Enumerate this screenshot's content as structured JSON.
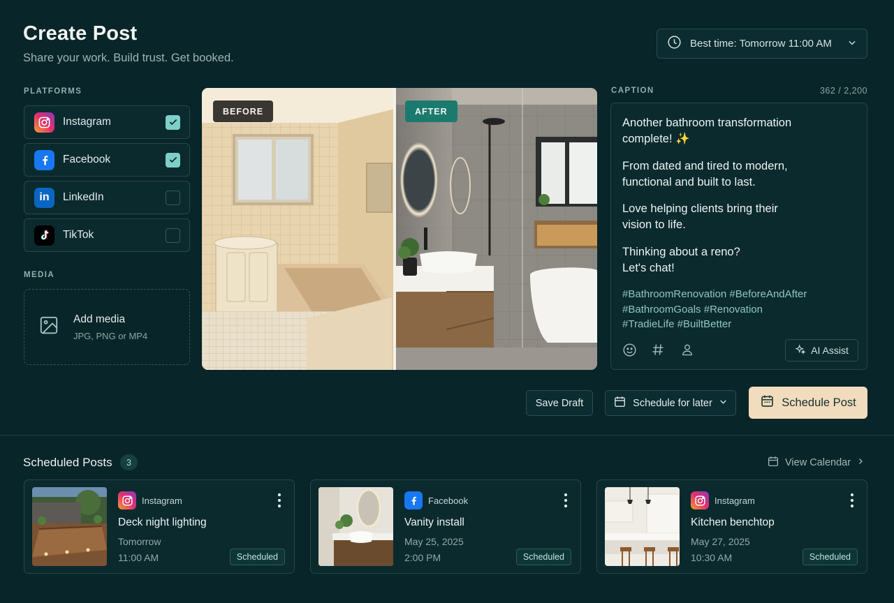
{
  "header": {
    "title": "Create Post",
    "subtitle": "Share your work. Build trust. Get booked.",
    "best_time": "Best time: Tomorrow 11:00 AM"
  },
  "platforms": {
    "label": "PLATFORMS",
    "items": [
      {
        "name": "Instagram",
        "checked": true,
        "icon": "instagram-icon"
      },
      {
        "name": "Facebook",
        "checked": true,
        "icon": "facebook-icon"
      },
      {
        "name": "LinkedIn",
        "checked": false,
        "icon": "linkedin-icon"
      },
      {
        "name": "TikTok",
        "checked": false,
        "icon": "tiktok-icon"
      }
    ]
  },
  "media": {
    "label": "MEDIA",
    "add_label": "Add media",
    "formats": "JPG, PNG or MP4"
  },
  "photo": {
    "before_label": "BEFORE",
    "after_label": "AFTER"
  },
  "caption": {
    "label": "CAPTION",
    "count": "362 / 2,200",
    "para1_line1": "Another bathroom transformation",
    "para1_line2": "complete! ✨",
    "para2_line1": "From dated and tired to modern,",
    "para2_line2": "functional and built to last.",
    "para3_line1": "Love helping clients bring their",
    "para3_line2": "vision to life.",
    "para4_line1": "Thinking about a reno?",
    "para4_line2": "Let's chat!",
    "hashtags_line1": "#BathroomRenovation #BeforeAndAfter",
    "hashtags_line2": "#BathroomGoals #Renovation",
    "hashtags_line3": "#TradieLife #BuiltBetter",
    "ai_assist": "AI Assist"
  },
  "actions": {
    "save_draft": "Save Draft",
    "schedule_later": "Schedule for later",
    "schedule_post": "Schedule Post"
  },
  "scheduled": {
    "title": "Scheduled Posts",
    "count": "3",
    "view_calendar": "View Calendar",
    "posts": [
      {
        "platform": "Instagram",
        "title": "Deck night lighting",
        "date": "Tomorrow",
        "time": "11:00 AM",
        "status": "Scheduled"
      },
      {
        "platform": "Facebook",
        "title": "Vanity install",
        "date": "May 25, 2025",
        "time": "2:00 PM",
        "status": "Scheduled"
      },
      {
        "platform": "Instagram",
        "title": "Kitchen benchtop",
        "date": "May 27, 2025",
        "time": "10:30 AM",
        "status": "Scheduled"
      }
    ]
  },
  "colors": {
    "background": "#082529",
    "accent": "#7fcfc9",
    "primary_button": "#f1dcbd",
    "hashtag": "#8fc7c3"
  }
}
